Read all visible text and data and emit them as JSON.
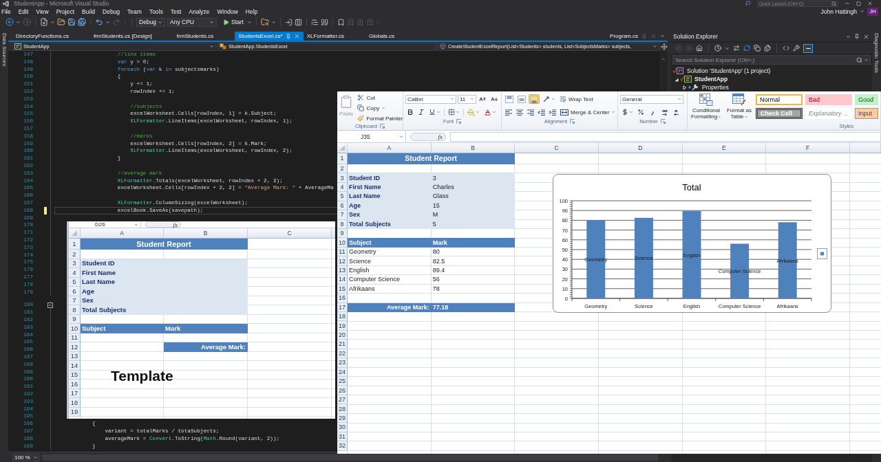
{
  "window": {
    "title": "StudentApp - Microsoft Visual Studio",
    "quick_launch": {
      "placeholder": "Quick Launch (Ctrl+Q)"
    }
  },
  "menu": [
    "File",
    "Edit",
    "View",
    "Project",
    "Build",
    "Debug",
    "Team",
    "Tools",
    "Test",
    "Analyze",
    "Window",
    "Help"
  ],
  "account": {
    "name": "John Hattingh",
    "initials": "JH"
  },
  "toolbar": {
    "configuration": "Debug",
    "platform": "Any CPU",
    "start": "Start"
  },
  "side_tabs": {
    "left": "Data Sources",
    "right": "Diagnostic Tools"
  },
  "document_tabs": [
    {
      "label": "DirectoryFunctions.cs",
      "selected": false
    },
    {
      "label": "frmStudents.cs [Design]",
      "selected": false
    },
    {
      "label": "frmStudents.cs",
      "selected": false
    },
    {
      "label": "StudentsExcel.cs*",
      "selected": true
    },
    {
      "label": "XLFormatter.cs",
      "selected": false
    },
    {
      "label": "Globals.cs",
      "selected": false
    }
  ],
  "preview_tab": {
    "label": "Program.cs"
  },
  "navigation": {
    "project": "StudentApp",
    "type": "StudentApp.StudentsExcel",
    "member": "CreateStudentExcelReport(List<Students> students, List<SubjectsMarks> subjects,"
  },
  "editor": {
    "lines": [
      {
        "number": "147",
        "kind": "line",
        "modified": false,
        "current": false,
        "code": [
          {
            "kind": "comment",
            "text": "                    //line items"
          }
        ]
      },
      {
        "number": "148",
        "kind": "line",
        "modified": false,
        "current": false,
        "code": [
          {
            "kind": "keyword",
            "text": "                    var"
          },
          {
            "kind": "plain",
            "text": " y = 0;"
          }
        ]
      },
      {
        "number": "149",
        "kind": "line",
        "modified": false,
        "current": false,
        "code": [
          {
            "kind": "keyword",
            "text": "                    foreach"
          },
          {
            "kind": "plain",
            "text": " ("
          },
          {
            "kind": "keyword",
            "text": "var"
          },
          {
            "kind": "plain",
            "text": " k "
          },
          {
            "kind": "keyword",
            "text": "in"
          },
          {
            "kind": "plain",
            "text": " subjectsmarks)"
          }
        ]
      },
      {
        "number": "150",
        "kind": "line",
        "modified": false,
        "current": false,
        "code": [
          {
            "kind": "plain",
            "text": "                    {"
          }
        ]
      },
      {
        "number": "151",
        "kind": "line",
        "modified": false,
        "current": false,
        "code": [
          {
            "kind": "plain",
            "text": "                        y += 1;"
          }
        ]
      },
      {
        "number": "152",
        "kind": "line",
        "modified": false,
        "current": false,
        "code": [
          {
            "kind": "plain",
            "text": "                        rowIndex += 1;"
          }
        ]
      },
      {
        "number": "153",
        "kind": "line",
        "modified": false,
        "current": false
      },
      {
        "number": "154",
        "kind": "line",
        "modified": false,
        "current": false,
        "code": [
          {
            "kind": "comment",
            "text": "                        //subjects"
          }
        ]
      },
      {
        "number": "155",
        "kind": "line",
        "modified": false,
        "current": false,
        "code": [
          {
            "kind": "plain",
            "text": "                        excelWorksheet.Cells[rowIndex, 1] = k.Subject;"
          }
        ]
      },
      {
        "number": "156",
        "kind": "line",
        "modified": false,
        "current": false,
        "code": [
          {
            "kind": "type",
            "text": "                        XLFormatter"
          },
          {
            "kind": "plain",
            "text": ".LineItems(excelWorksheet, rowIndex, 1);"
          }
        ]
      },
      {
        "number": "157",
        "kind": "line",
        "modified": false,
        "current": false
      },
      {
        "number": "158",
        "kind": "line",
        "modified": false,
        "current": false,
        "code": [
          {
            "kind": "comment",
            "text": "                        //marks"
          }
        ]
      },
      {
        "number": "159",
        "kind": "line",
        "modified": false,
        "current": false,
        "code": [
          {
            "kind": "plain",
            "text": "                        excelWorksheet.Cells[rowIndex, 2] = k.Mark;"
          }
        ]
      },
      {
        "number": "160",
        "kind": "line",
        "modified": false,
        "current": false,
        "code": [
          {
            "kind": "type",
            "text": "                        XLFormatter"
          },
          {
            "kind": "plain",
            "text": ".LineItems(excelWorksheet, rowIndex, 2);"
          }
        ]
      },
      {
        "number": "161",
        "kind": "line",
        "modified": false,
        "current": false,
        "code": [
          {
            "kind": "plain",
            "text": "                    }"
          }
        ]
      },
      {
        "number": "162",
        "kind": "line",
        "modified": false,
        "current": false
      },
      {
        "number": "163",
        "kind": "line",
        "modified": false,
        "current": false,
        "code": [
          {
            "kind": "comment",
            "text": "                    //average mark"
          }
        ]
      },
      {
        "number": "164",
        "kind": "line",
        "modified": false,
        "current": false,
        "code": [
          {
            "kind": "type",
            "text": "                    XLFormatter"
          },
          {
            "kind": "plain",
            "text": ".Totals(excelWorksheet, rowIndex + 2, 2);"
          }
        ]
      },
      {
        "number": "165",
        "kind": "line",
        "modified": false,
        "current": false,
        "code": [
          {
            "kind": "plain",
            "text": "                    excelWorksheet.Cells[rowIndex + 2, 2] = "
          },
          {
            "kind": "string",
            "text": "\"Average Mark: \""
          },
          {
            "kind": "plain",
            "text": " + AverageMa"
          }
        ]
      },
      {
        "number": "166",
        "kind": "line",
        "modified": false,
        "current": false
      },
      {
        "number": "167",
        "kind": "line",
        "modified": false,
        "current": false,
        "code": [
          {
            "kind": "type",
            "text": "                    XLFormatter"
          },
          {
            "kind": "plain",
            "text": ".ColumnSizing(excelWorksheet);"
          }
        ]
      },
      {
        "number": "168",
        "kind": "line",
        "modified": true,
        "current": true,
        "code": [
          {
            "kind": "plain",
            "text": "                    excelBook.SaveAs(savepath);"
          }
        ]
      },
      {
        "number": "169",
        "kind": "line",
        "modified": false,
        "current": false
      },
      {
        "number": "170",
        "kind": "line",
        "modified": false,
        "current": false
      },
      {
        "number": "171",
        "kind": "line",
        "modified": false,
        "current": false
      },
      {
        "number": "172",
        "kind": "line",
        "modified": false,
        "current": false
      },
      {
        "number": "173",
        "kind": "line",
        "modified": false,
        "current": false
      },
      {
        "number": "174",
        "kind": "line",
        "modified": false,
        "current": false
      },
      {
        "number": "175",
        "kind": "line",
        "modified": false,
        "current": false
      },
      {
        "number": "176",
        "kind": "line",
        "modified": false,
        "current": false
      },
      {
        "number": "177",
        "kind": "line",
        "modified": false,
        "current": false
      },
      {
        "number": "178",
        "kind": "line",
        "modified": false,
        "current": false
      },
      {
        "number": "179",
        "kind": "line",
        "modified": false,
        "current": false
      },
      {
        "number": "180",
        "kind": "block",
        "modified": false,
        "current": false
      },
      {
        "number": "181",
        "kind": "line",
        "modified": false,
        "current": false
      },
      {
        "number": "182",
        "kind": "line",
        "modified": false,
        "current": false
      },
      {
        "number": "183",
        "kind": "line",
        "modified": false,
        "current": false
      },
      {
        "number": "184",
        "kind": "line",
        "modified": false,
        "current": false
      },
      {
        "number": "185",
        "kind": "line",
        "modified": false,
        "current": false
      },
      {
        "number": "186",
        "kind": "line",
        "modified": false,
        "current": false
      },
      {
        "number": "187",
        "kind": "line",
        "modified": false,
        "current": false
      },
      {
        "number": "188",
        "kind": "line",
        "modified": false,
        "current": false
      },
      {
        "number": "189",
        "kind": "line",
        "modified": false,
        "current": false
      },
      {
        "number": "190",
        "kind": "line",
        "modified": false,
        "current": false
      },
      {
        "number": "191",
        "kind": "line",
        "modified": false,
        "current": false
      },
      {
        "number": "192",
        "kind": "line",
        "modified": false,
        "current": false
      },
      {
        "number": "193",
        "kind": "line",
        "modified": false,
        "current": false
      },
      {
        "number": "194",
        "kind": "line",
        "modified": false,
        "current": false
      },
      {
        "number": "195",
        "kind": "line",
        "modified": false,
        "current": false
      },
      {
        "number": "196",
        "kind": "line",
        "modified": false,
        "current": false,
        "code": [
          {
            "kind": "plain",
            "text": "            {"
          }
        ]
      },
      {
        "number": "197",
        "kind": "line",
        "modified": false,
        "current": false,
        "code": [
          {
            "kind": "plain",
            "text": "                variant = totalMarks / totaSubjects;"
          }
        ]
      },
      {
        "number": "198",
        "kind": "line",
        "modified": false,
        "current": false,
        "code": [
          {
            "kind": "plain",
            "text": "                averageMark = "
          },
          {
            "kind": "type",
            "text": "Convert"
          },
          {
            "kind": "plain",
            "text": ".ToString("
          },
          {
            "kind": "type",
            "text": "Math"
          },
          {
            "kind": "plain",
            "text": ".Round(variant, 2));"
          }
        ]
      },
      {
        "number": "199",
        "kind": "line",
        "modified": false,
        "current": false,
        "code": [
          {
            "kind": "plain",
            "text": "            }"
          }
        ]
      }
    ],
    "zoom": "100 %"
  },
  "solution_explorer": {
    "title": "Solution Explorer",
    "preview_selected": true,
    "search": {
      "placeholder": "Search Solution Explorer (Ctrl+;)"
    },
    "tree": [
      {
        "label": "Solution 'StudentApp' (1 project)",
        "kind": "solution",
        "children": [
          {
            "label": "StudentApp",
            "kind": "project",
            "expanded": true,
            "children": [
              {
                "label": "Properties",
                "kind": "properties",
                "expanded": false
              }
            ]
          }
        ]
      }
    ]
  },
  "excel_report": {
    "ribbon": {
      "clipboard": {
        "label": "Clipboard",
        "paste": {
          "label": "Paste",
          "disabled": true
        },
        "cut": "Cut",
        "copy": "Copy",
        "format_painter": "Format Painter"
      },
      "font": {
        "label": "Font",
        "family": "Calibri",
        "size": "11"
      },
      "alignment": {
        "label": "Alignment",
        "vertical": [
          {
            "selected": false
          },
          {
            "selected": false
          },
          {
            "selected": true
          }
        ],
        "wrap_text": "Wrap Text",
        "merge": "Merge & Center"
      },
      "number": {
        "label": "Number",
        "format": "General"
      },
      "styles": {
        "label": "Styles",
        "conditional": "Conditional Formatting",
        "format_table": "Format as Table",
        "cells": [
          {
            "label": "Normal",
            "kind": "normal",
            "selected": true
          },
          {
            "label": "Bad",
            "kind": "bad",
            "selected": false
          },
          {
            "label": "Good",
            "kind": "good",
            "selected": false
          },
          {
            "label": "Check Cell",
            "kind": "check",
            "selected": false
          },
          {
            "label": "Explanatory ...",
            "kind": "explanatory",
            "selected": false
          },
          {
            "label": "Input",
            "kind": "input",
            "selected": false
          }
        ]
      }
    },
    "name_box": "J35",
    "insert_function": "fx",
    "columns": [
      "A",
      "B",
      "C",
      "D",
      "E",
      "F"
    ],
    "rows": [
      {
        "number": "1",
        "cells": [
          {
            "kind": "title",
            "text": "Student Report"
          }
        ]
      },
      {
        "number": "2"
      },
      {
        "number": "3",
        "cells": [
          {
            "kind": "label",
            "text": "Student ID"
          },
          {
            "kind": "fill",
            "text": "3"
          }
        ]
      },
      {
        "number": "4",
        "cells": [
          {
            "kind": "label",
            "text": "First Name"
          },
          {
            "kind": "fill",
            "text": "Charles"
          }
        ]
      },
      {
        "number": "5",
        "cells": [
          {
            "kind": "label",
            "text": "Last Name"
          },
          {
            "kind": "fill",
            "text": "Glass"
          }
        ]
      },
      {
        "number": "6",
        "cells": [
          {
            "kind": "label",
            "text": "Age"
          },
          {
            "kind": "fill",
            "text": "15"
          }
        ]
      },
      {
        "number": "7",
        "cells": [
          {
            "kind": "label",
            "text": "Sex"
          },
          {
            "kind": "fill",
            "text": "M"
          }
        ]
      },
      {
        "number": "8",
        "cells": [
          {
            "kind": "label",
            "text": "Total Subjects"
          },
          {
            "kind": "fill",
            "text": "5"
          }
        ]
      },
      {
        "number": "9"
      },
      {
        "number": "10",
        "cells": [
          {
            "kind": "header",
            "text": "Subject"
          },
          {
            "kind": "header",
            "text": "Mark"
          }
        ]
      },
      {
        "number": "11",
        "cells": [
          {
            "kind": "plain",
            "text": "Geometry"
          },
          {
            "kind": "plain",
            "text": "80"
          }
        ]
      },
      {
        "number": "12",
        "cells": [
          {
            "kind": "plain",
            "text": "Science"
          },
          {
            "kind": "plain",
            "text": "82.5"
          }
        ]
      },
      {
        "number": "13",
        "cells": [
          {
            "kind": "plain",
            "text": "English"
          },
          {
            "kind": "plain",
            "text": "89.4"
          }
        ]
      },
      {
        "number": "14",
        "cells": [
          {
            "kind": "plain",
            "text": "Computer Science"
          },
          {
            "kind": "plain",
            "text": "56"
          }
        ]
      },
      {
        "number": "15",
        "cells": [
          {
            "kind": "plain",
            "text": "Afrikaans"
          },
          {
            "kind": "plain",
            "text": "78"
          }
        ]
      },
      {
        "number": "16"
      },
      {
        "number": "17",
        "cells": [
          {
            "kind": "total",
            "text": "Average Mark:"
          },
          {
            "kind": "header",
            "text": "77.18"
          }
        ]
      },
      {
        "number": "18"
      },
      {
        "number": "19"
      },
      {
        "number": "20"
      },
      {
        "number": "21"
      },
      {
        "number": "22"
      },
      {
        "number": "23"
      },
      {
        "number": "24"
      },
      {
        "number": "25"
      },
      {
        "number": "26"
      },
      {
        "number": "27"
      },
      {
        "number": "28"
      },
      {
        "number": "29"
      },
      {
        "number": "30"
      },
      {
        "number": "31"
      },
      {
        "number": "32"
      }
    ],
    "chart_data": {
      "type": "bar",
      "title": "Total",
      "categories": [
        "Geometry",
        "Science",
        "English",
        "Computer Science",
        "Afrikaans"
      ],
      "values": [
        80,
        82.5,
        89.4,
        56,
        78
      ],
      "color": "#4f81bd",
      "ylim": [
        0,
        100
      ],
      "yticks": [
        0,
        10,
        20,
        30,
        40,
        50,
        60,
        70,
        80,
        90,
        100
      ],
      "grid": true,
      "value_labels": [
        "Geometry",
        "Science",
        "English",
        "Computer Science",
        "Afrikaans"
      ]
    }
  },
  "excel_template": {
    "name_box": "D26",
    "insert_function": "fx",
    "columns": [
      "A",
      "B",
      "C"
    ],
    "rows": [
      {
        "number": "1",
        "cells": [
          {
            "kind": "title",
            "text": "Student Report"
          }
        ]
      },
      {
        "number": "2"
      },
      {
        "number": "3",
        "cells": [
          {
            "kind": "label",
            "text": "Student ID"
          },
          {
            "kind": "fill"
          }
        ]
      },
      {
        "number": "4",
        "cells": [
          {
            "kind": "label",
            "text": "First Name"
          },
          {
            "kind": "fill"
          }
        ]
      },
      {
        "number": "5",
        "cells": [
          {
            "kind": "label",
            "text": "Last Name"
          },
          {
            "kind": "fill"
          }
        ]
      },
      {
        "number": "6",
        "cells": [
          {
            "kind": "label",
            "text": "Age"
          },
          {
            "kind": "fill"
          }
        ]
      },
      {
        "number": "7",
        "cells": [
          {
            "kind": "label",
            "text": "Sex"
          },
          {
            "kind": "fill"
          }
        ]
      },
      {
        "number": "8",
        "cells": [
          {
            "kind": "label",
            "text": "Total Subjects"
          },
          {
            "kind": "fill"
          }
        ]
      },
      {
        "number": "9"
      },
      {
        "number": "10",
        "cells": [
          {
            "kind": "header",
            "text": "Subject"
          },
          {
            "kind": "header",
            "text": "Mark"
          }
        ]
      },
      {
        "number": "11"
      },
      {
        "number": "12",
        "cells": [
          {
            "kind": "plain"
          },
          {
            "kind": "total",
            "text": "Average Mark:"
          }
        ]
      },
      {
        "number": "13"
      },
      {
        "number": "14"
      },
      {
        "number": "15"
      },
      {
        "number": "16"
      },
      {
        "number": "17"
      },
      {
        "number": "18"
      },
      {
        "number": "19"
      }
    ],
    "caption": "Template"
  }
}
